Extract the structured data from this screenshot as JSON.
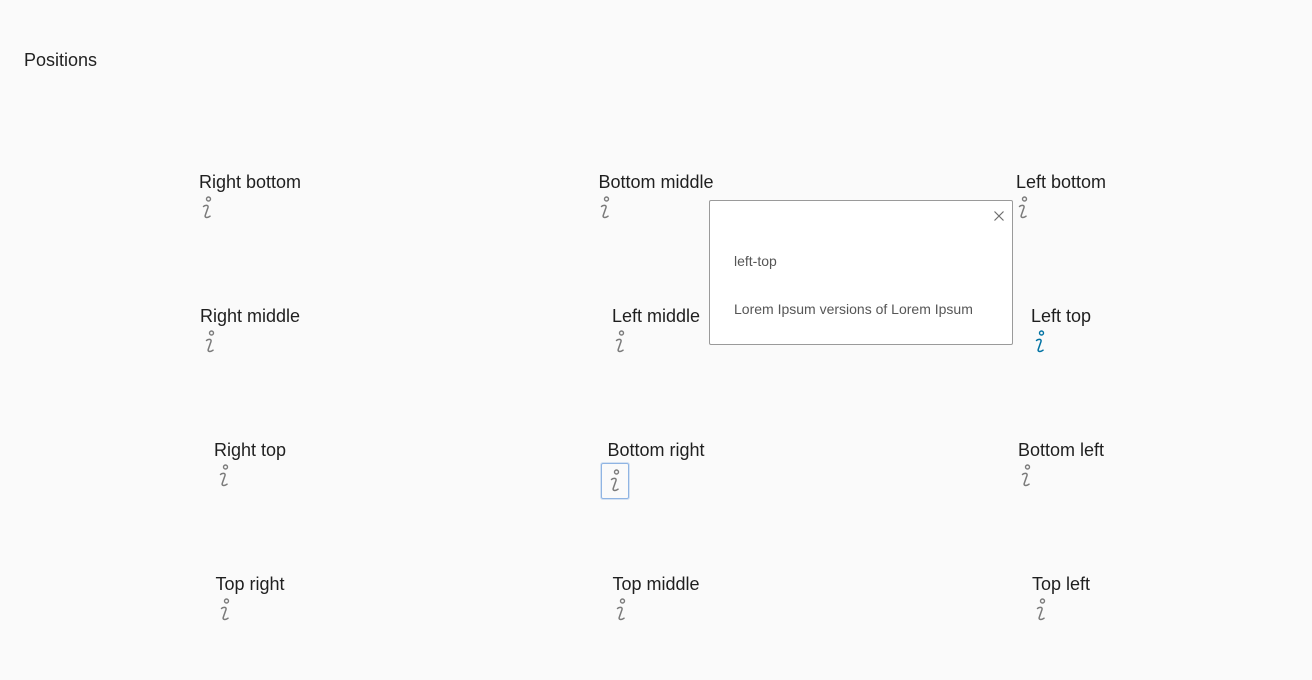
{
  "section": {
    "title": "Positions"
  },
  "positions": [
    {
      "label": "Right bottom",
      "active": false,
      "focused": false
    },
    {
      "label": "Bottom middle",
      "active": false,
      "focused": false
    },
    {
      "label": "Left bottom",
      "active": false,
      "focused": false
    },
    {
      "label": "Right middle",
      "active": false,
      "focused": false
    },
    {
      "label": "Left middle",
      "active": false,
      "focused": false
    },
    {
      "label": "Left top",
      "active": true,
      "focused": false
    },
    {
      "label": "Right top",
      "active": false,
      "focused": false
    },
    {
      "label": "Bottom right",
      "active": false,
      "focused": true
    },
    {
      "label": "Bottom left",
      "active": false,
      "focused": false
    },
    {
      "label": "Top right",
      "active": false,
      "focused": false
    },
    {
      "label": "Top middle",
      "active": false,
      "focused": false
    },
    {
      "label": "Top left",
      "active": false,
      "focused": false
    }
  ],
  "signpost": {
    "heading": "left-top",
    "body": "Lorem Ipsum versions of Lorem Ipsum",
    "close_icon": "close-icon"
  },
  "colors": {
    "icon_default": "#7a7a7a",
    "icon_active": "#0072a3",
    "focus_ring": "#8fb4e3"
  },
  "icons": {
    "trigger": "info-icon"
  }
}
